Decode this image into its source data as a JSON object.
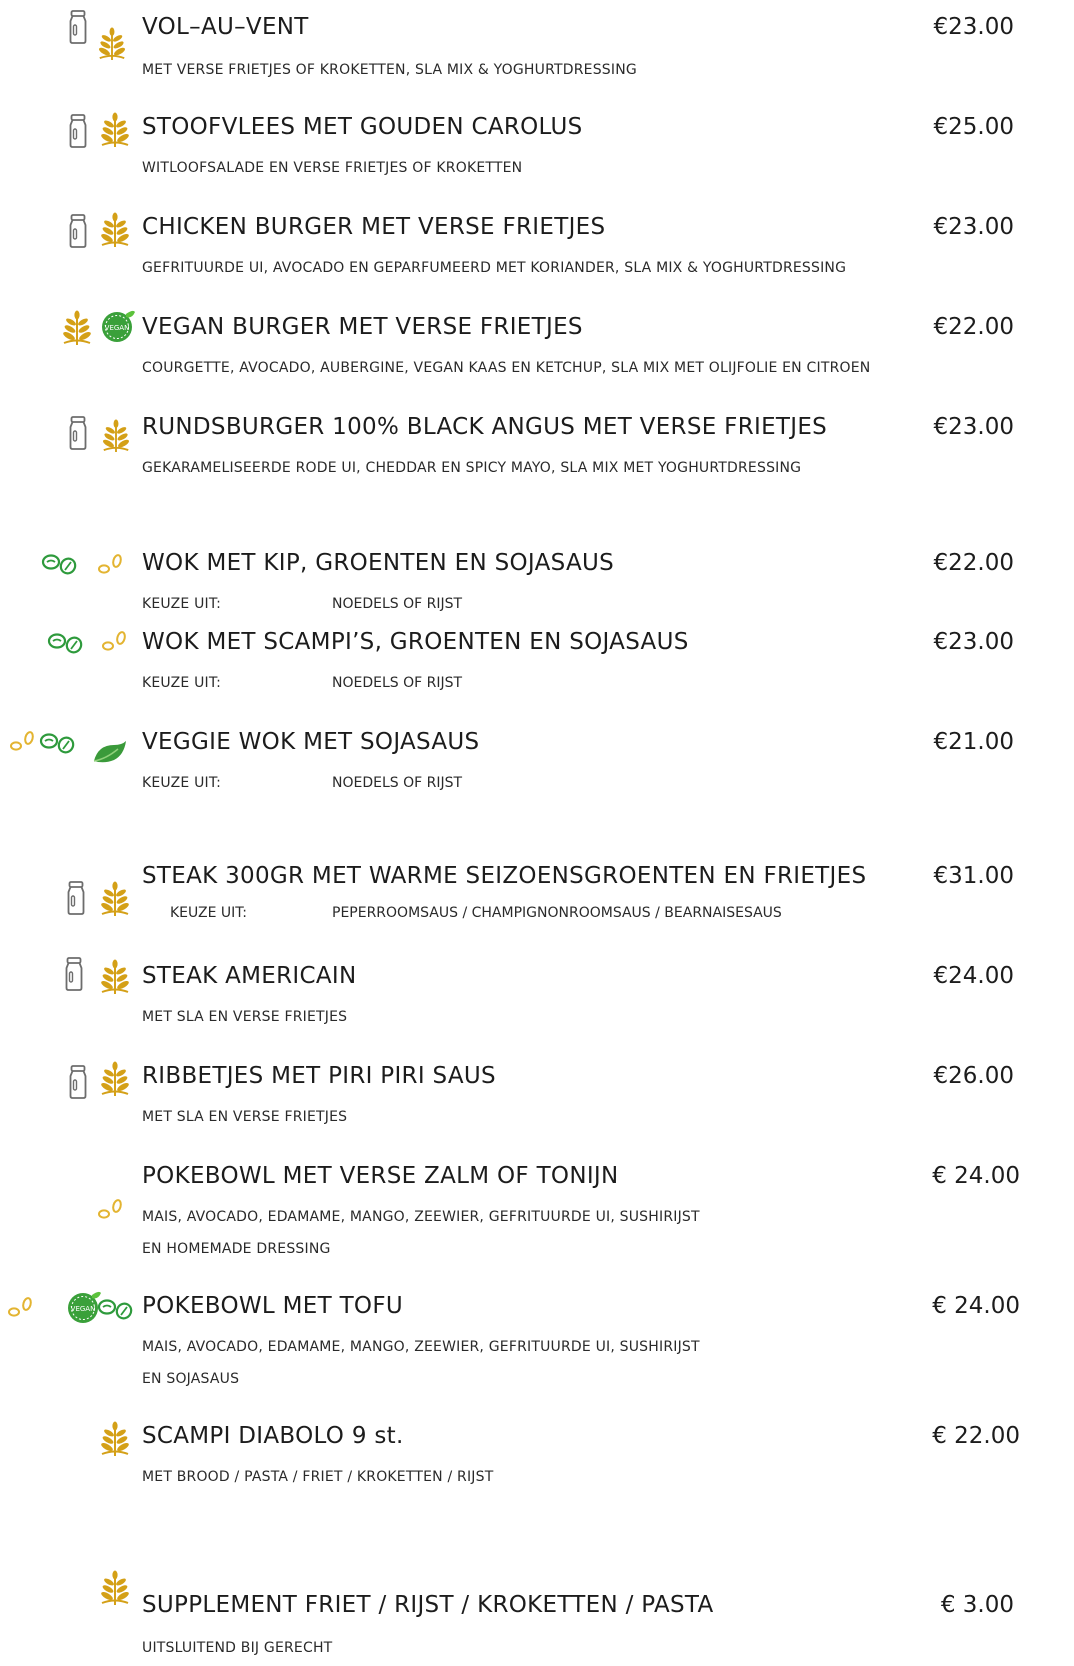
{
  "menu": {
    "items": [
      {
        "title": "VOL–AU–VENT",
        "price": "€23.00",
        "description": "MET VERSE FRIETJES OF KROKETTEN, SLA MIX & YOGHURTDRESSING",
        "icons": [
          "milk-bottle-icon",
          "wheat-icon"
        ]
      },
      {
        "title": "STOOFVLEES MET GOUDEN CAROLUS",
        "price": "€25.00",
        "description": "WITLOOFSALADE EN VERSE FRIETJES OF KROKETTEN",
        "icons": [
          "milk-bottle-icon",
          "wheat-icon"
        ]
      },
      {
        "title": "CHICKEN BURGER MET VERSE FRIETJES",
        "price": "€23.00",
        "description": "GEFRITUURDE UI, AVOCADO EN GEPARFUMEERD MET KORIANDER, SLA MIX & YOGHURTDRESSING",
        "icons": [
          "milk-bottle-icon",
          "wheat-icon"
        ]
      },
      {
        "title": "VEGAN BURGER MET VERSE FRIETJES",
        "price": "€22.00",
        "description": "COURGETTE, AVOCADO, AUBERGINE, VEGAN KAAS EN KETCHUP, SLA MIX MET OLIJFOLIE EN CITROEN",
        "icons": [
          "wheat-icon",
          "vegan-badge-icon"
        ]
      },
      {
        "title": "RUNDSBURGER 100% BLACK ANGUS MET VERSE  FRIETJES",
        "price": "€23.00",
        "description": "GEKARAMELISEERDE RODE UI, CHEDDAR EN SPICY MAYO, SLA MIX MET YOGHURTDRESSING",
        "icons": [
          "milk-bottle-icon",
          "wheat-icon"
        ]
      },
      {
        "title": "WOK MET KIP, GROENTEN EN SOJASAUS",
        "price": "€22.00",
        "option_label": "KEUZE UIT:",
        "option_value": "NOEDELS OF RIJST",
        "icons": [
          "soy-bean-icon",
          "sesame-icon"
        ]
      },
      {
        "title": "WOK MET SCAMPI’S, GROENTEN EN SOJASAUS",
        "price": "€23.00",
        "option_label": "KEUZE UIT:",
        "option_value": "NOEDELS OF RIJST",
        "icons": [
          "soy-bean-icon",
          "sesame-icon"
        ]
      },
      {
        "title": "VEGGIE WOK MET SOJASAUS",
        "price": "€21.00",
        "option_label": "KEUZE UIT:",
        "option_value": "NOEDELS OF RIJST",
        "icons": [
          "sesame-icon",
          "soy-bean-icon",
          "vegetarian-leaf-icon"
        ]
      },
      {
        "title": "STEAK 300GR MET WARME SEIZOENSGROENTEN EN FRIETJES",
        "price": "€31.00",
        "option_label": "KEUZE UIT:",
        "option_value": "PEPERROOMSAUS / CHAMPIGNONROOMSAUS / BEARNAISESAUS",
        "icons": [
          "milk-bottle-icon",
          "wheat-icon"
        ]
      },
      {
        "title": "STEAK AMERICAIN",
        "price": "€24.00",
        "description": "MET SLA EN VERSE FRIETJES",
        "icons": [
          "milk-bottle-icon",
          "wheat-icon"
        ]
      },
      {
        "title": "RIBBETJES MET PIRI PIRI SAUS",
        "price": "€26.00",
        "description": "MET SLA EN VERSE FRIETJES",
        "icons": [
          "milk-bottle-icon",
          "wheat-icon"
        ]
      },
      {
        "title": "POKEBOWL MET VERSE ZALM OF TONIJN",
        "price": "€ 24.00",
        "description": "MAIS, AVOCADO, EDAMAME, MANGO, ZEEWIER, GEFRITUURDE UI, SUSHIRIJST",
        "description2": "EN HOMEMADE DRESSING",
        "icons": [
          "sesame-icon"
        ]
      },
      {
        "title": "POKEBOWL MET TOFU",
        "price": "€ 24.00",
        "description": "MAIS, AVOCADO, EDAMAME, MANGO, ZEEWIER, GEFRITUURDE UI, SUSHIRIJST",
        "description2": "EN SOJASAUS",
        "icons": [
          "sesame-icon",
          "vegan-badge-icon",
          "soy-bean-icon"
        ]
      },
      {
        "title": "SCAMPI DIABOLO 9 st.",
        "price": "€ 22.00",
        "description": "MET BROOD / PASTA / FRIET / KROKETTEN / RIJST",
        "icons": [
          "wheat-icon"
        ]
      },
      {
        "title": "SUPPLEMENT FRIET / RIJST / KROKETTEN / PASTA",
        "price": "€ 3.00",
        "description": "UITSLUITEND BIJ GERECHT",
        "icons": [
          "wheat-icon"
        ]
      }
    ]
  },
  "colors": {
    "wheat": "#d4a017",
    "soy": "#2e9a3c",
    "sesame": "#e3b431",
    "vegan": "#3aa03a",
    "milk": "#6d6d6d",
    "text": "#1c1c1c"
  }
}
